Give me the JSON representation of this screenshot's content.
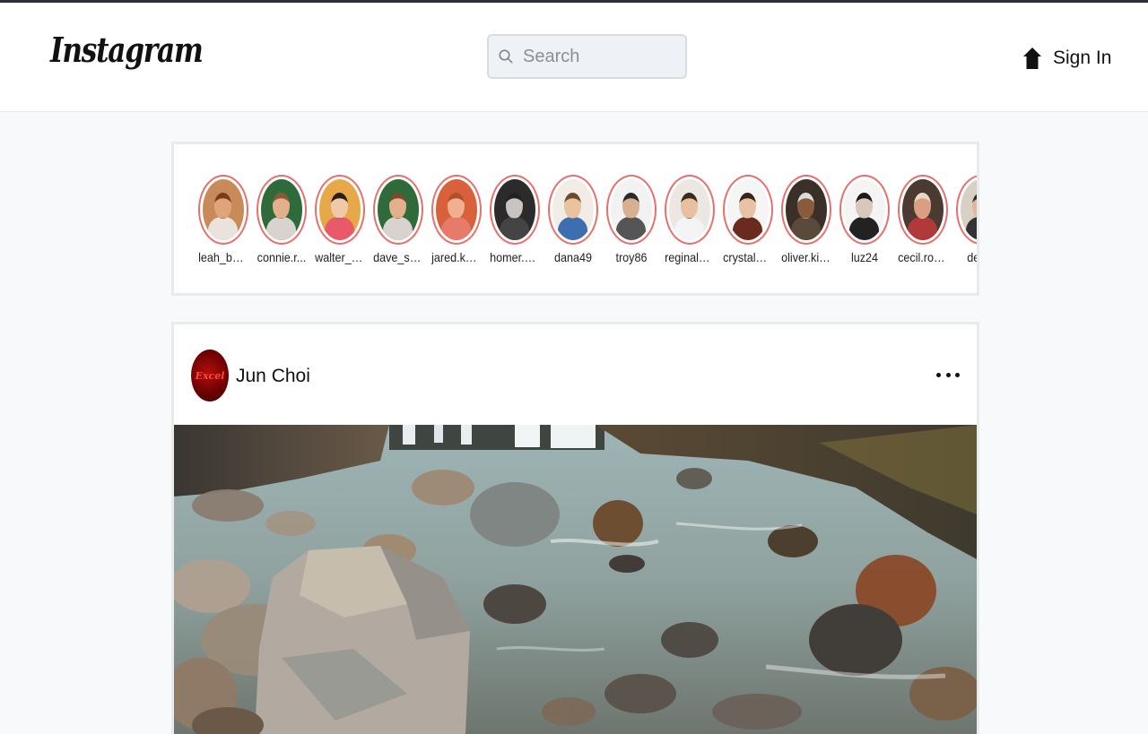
{
  "header": {
    "logo": "Instagram",
    "search": {
      "placeholder": "Search",
      "value": ""
    },
    "sign_in": "Sign In"
  },
  "stories": [
    {
      "name": "leah_bail...",
      "skin": "#e0a47a",
      "hair": "#7a3c18",
      "bg": "#c98a5a",
      "shirt": "#e9e3dc"
    },
    {
      "name": "connie.r...",
      "skin": "#e3b08e",
      "hair": "#8b5a34",
      "bg": "#2f6b3a",
      "shirt": "#d8d3cc"
    },
    {
      "name": "walter_h...",
      "skin": "#f0c9a8",
      "hair": "#2a1d16",
      "bg": "#e7a84a",
      "shirt": "#e85a6a"
    },
    {
      "name": "dave_sto...",
      "skin": "#e3b08e",
      "hair": "#7c4b29",
      "bg": "#2e6a3a",
      "shirt": "#d8d3cc"
    },
    {
      "name": "jared.kas...",
      "skin": "#f0b090",
      "hair": "#b0502a",
      "bg": "#d8603a",
      "shirt": "#e87a6a"
    },
    {
      "name": "homer.w...",
      "skin": "#c9c4c0",
      "hair": "#222222",
      "bg": "#2b2b2b",
      "shirt": "#444444"
    },
    {
      "name": "dana49",
      "skin": "#e9c2a0",
      "hair": "#6b4a30",
      "bg": "#f1ede6",
      "shirt": "#3d6fb0"
    },
    {
      "name": "troy86",
      "skin": "#d8b090",
      "hair": "#2a2a2a",
      "bg": "#f2f2f2",
      "shirt": "#555555"
    },
    {
      "name": "reginald....",
      "skin": "#e8c0a0",
      "hair": "#3a2a20",
      "bg": "#ece7e2",
      "shirt": "#f4f4f4"
    },
    {
      "name": "crystal_c...",
      "skin": "#e8c2a5",
      "hair": "#3b2418",
      "bg": "#f5f5f5",
      "shirt": "#6b2a1f"
    },
    {
      "name": "oliver.kihn",
      "skin": "#8a5a3c",
      "hair": "#dcdcdc",
      "bg": "#3a3028",
      "shirt": "#5a4a3a"
    },
    {
      "name": "luz24",
      "skin": "#d8c8bc",
      "hair": "#1a1a1a",
      "bg": "#f4f4f4",
      "shirt": "#222222"
    },
    {
      "name": "cecil.roh...",
      "skin": "#d8a080",
      "hair": "#e8d8c8",
      "bg": "#4a3a32",
      "shirt": "#b03a3a"
    },
    {
      "name": "derek",
      "skin": "#e0b898",
      "hair": "#2a2a2a",
      "bg": "#d8d0c4",
      "shirt": "#333333"
    }
  ],
  "post": {
    "author": "Jun Choi",
    "avatar_text": "Excel",
    "more_icon": "ellipsis-icon"
  }
}
